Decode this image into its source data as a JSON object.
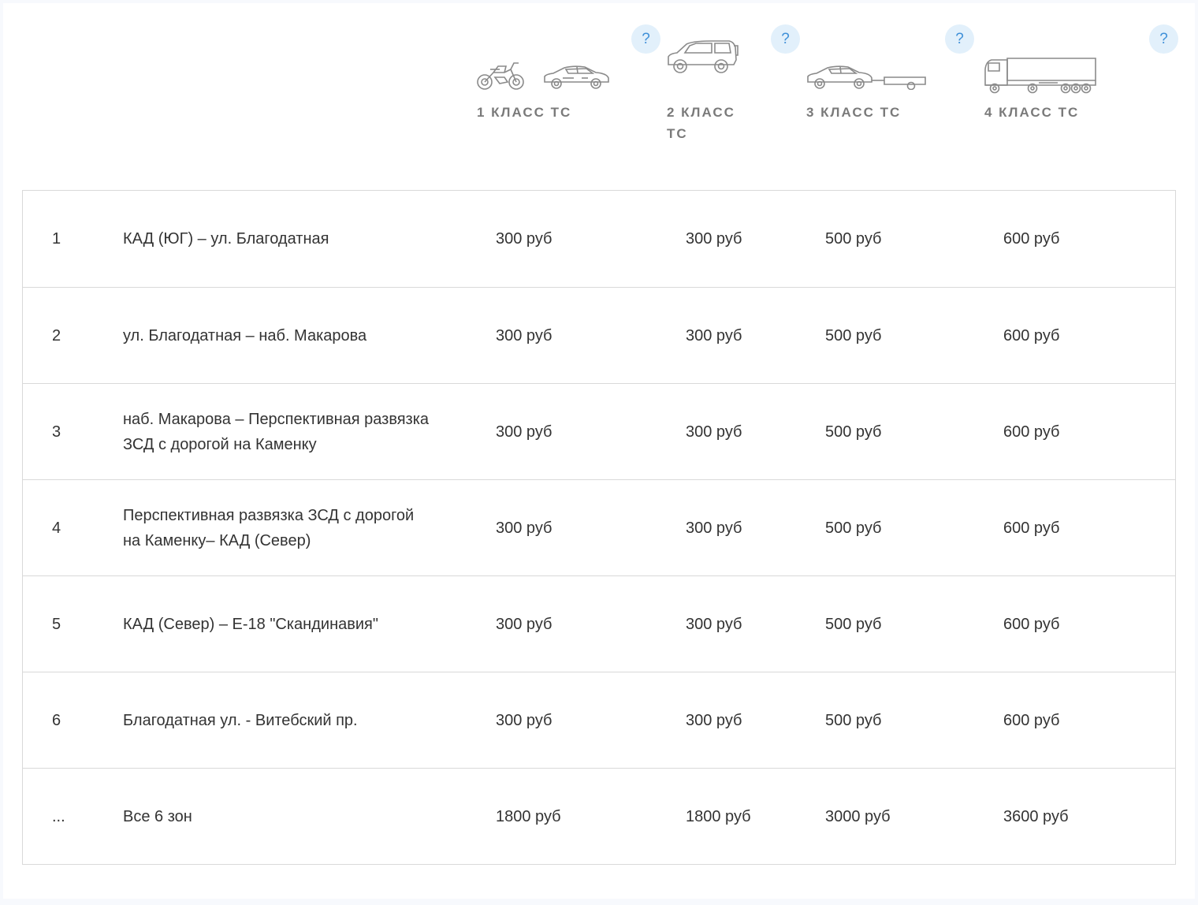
{
  "help_symbol": "?",
  "classes": [
    {
      "label": "1 класс ТС",
      "icons": [
        "motorcycle-icon",
        "sedan-icon"
      ]
    },
    {
      "label": "2 класс ТС",
      "icons": [
        "suv-icon"
      ]
    },
    {
      "label": "3 класс ТС",
      "icons": [
        "car-with-trailer-icon"
      ]
    },
    {
      "label": "4 класс ТС",
      "icons": [
        "truck-icon"
      ]
    }
  ],
  "rows": [
    {
      "num": "1",
      "name": "КАД (ЮГ) – ул. Благодатная",
      "prices": [
        "300 руб",
        "300 руб",
        "500 руб",
        "600 руб"
      ]
    },
    {
      "num": "2",
      "name": "ул. Благодатная – наб. Макарова",
      "prices": [
        "300 руб",
        "300 руб",
        "500 руб",
        "600 руб"
      ]
    },
    {
      "num": "3",
      "name": "наб. Макарова – Перспективная развязка ЗСД с дорогой на Каменку",
      "prices": [
        "300 руб",
        "300 руб",
        "500 руб",
        "600 руб"
      ]
    },
    {
      "num": "4",
      "name": "Перспективная развязка ЗСД с дорогой на Каменку– КАД (Север)",
      "prices": [
        "300 руб",
        "300 руб",
        "500 руб",
        "600 руб"
      ]
    },
    {
      "num": "5",
      "name": "КАД (Север) – Е-18 \"Скандинавия\"",
      "prices": [
        "300 руб",
        "300 руб",
        "500 руб",
        "600 руб"
      ]
    },
    {
      "num": "6",
      "name": "Благодатная ул. - Витебский пр.",
      "prices": [
        "300 руб",
        "300 руб",
        "500 руб",
        "600 руб"
      ]
    },
    {
      "num": "...",
      "name": "Все 6 зон",
      "prices": [
        "1800 руб",
        "1800 руб",
        "3000 руб",
        "3600 руб"
      ]
    }
  ],
  "colors": {
    "help_bg": "#e2f0fb",
    "help_fg": "#3f90d8",
    "label": "#7a7a7a",
    "border": "#d9d9d9",
    "text": "#333333"
  }
}
